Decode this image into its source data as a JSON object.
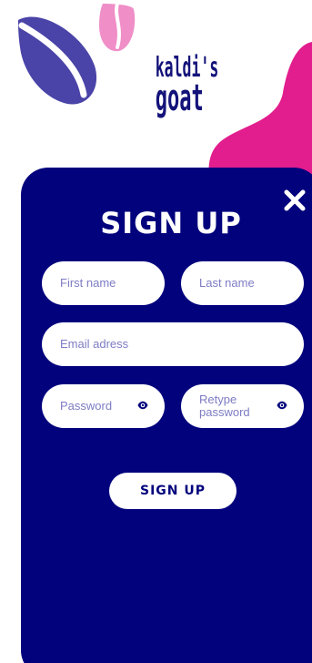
{
  "brand": {
    "logo_line1": "kaldi's",
    "logo_line2": "goat"
  },
  "form": {
    "title": "SIGN UP",
    "first_name_placeholder": "First name",
    "last_name_placeholder": "Last name",
    "email_placeholder": "Email adress",
    "password_placeholder": "Password",
    "retype_password_line1": "Retype",
    "retype_password_line2": "password",
    "submit_label": "SIGN UP"
  },
  "icons": {
    "close": "close-icon",
    "eye": "eye-icon"
  },
  "colors": {
    "panel": "#02027d",
    "accent_pink": "#e21d8d",
    "bean_blue": "#4a44a8",
    "bean_pink": "#ef8ec7",
    "placeholder": "#7d7cc4"
  }
}
